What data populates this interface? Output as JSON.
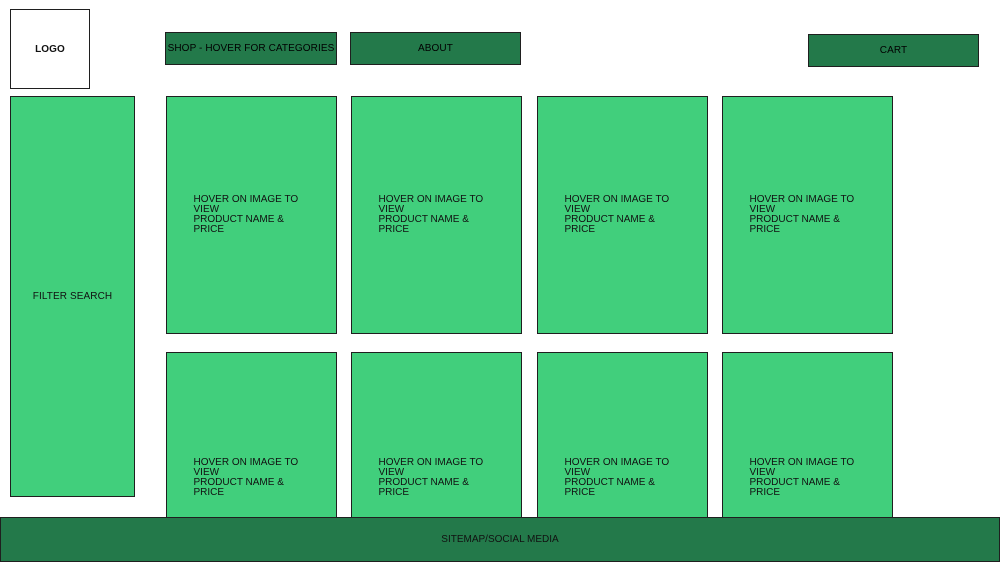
{
  "header": {
    "logo": "LOGO",
    "nav": {
      "shop": "SHOP - HOVER FOR CATEGORIES",
      "about": "ABOUT",
      "cart": "CART"
    }
  },
  "sidebar": {
    "filter": "FILTER SEARCH"
  },
  "products": [
    {
      "line1": "HOVER ON IMAGE TO VIEW",
      "line2": "PRODUCT NAME & PRICE"
    },
    {
      "line1": "HOVER ON IMAGE TO VIEW",
      "line2": "PRODUCT NAME & PRICE"
    },
    {
      "line1": "HOVER ON IMAGE TO VIEW",
      "line2": "PRODUCT NAME & PRICE"
    },
    {
      "line1": "HOVER ON IMAGE TO VIEW",
      "line2": "PRODUCT NAME & PRICE"
    },
    {
      "line1": "HOVER ON IMAGE TO VIEW",
      "line2": "PRODUCT NAME & PRICE"
    },
    {
      "line1": "HOVER ON IMAGE TO VIEW",
      "line2": "PRODUCT NAME & PRICE"
    },
    {
      "line1": "HOVER ON IMAGE TO VIEW",
      "line2": "PRODUCT NAME & PRICE"
    },
    {
      "line1": "HOVER ON IMAGE TO VIEW",
      "line2": "PRODUCT NAME & PRICE"
    }
  ],
  "footer": {
    "text": "SITEMAP/SOCIAL MEDIA"
  },
  "colors": {
    "tile_green": "#41cf7c",
    "nav_green": "#23794a",
    "border": "#1f1f1f",
    "background": "#ffffff"
  }
}
